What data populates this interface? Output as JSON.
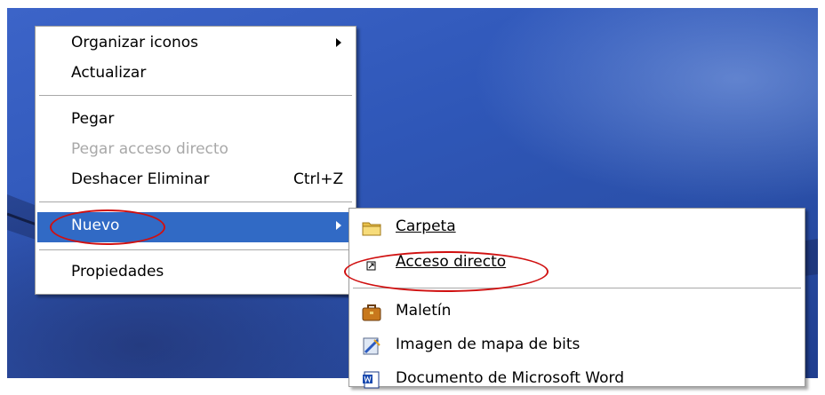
{
  "context_menu": {
    "items": [
      {
        "label": "Organizar iconos",
        "has_submenu": true
      },
      {
        "label": "Actualizar"
      },
      {
        "label": "Pegar"
      },
      {
        "label": "Pegar acceso directo",
        "disabled": true
      },
      {
        "label": "Deshacer Eliminar",
        "shortcut": "Ctrl+Z"
      },
      {
        "label": "Nuevo",
        "has_submenu": true,
        "selected": true
      },
      {
        "label": "Propiedades"
      }
    ]
  },
  "submenu_nuevo": {
    "items": [
      {
        "label": "Carpeta",
        "icon": "folder-icon",
        "mnemonic": "C"
      },
      {
        "label": "Acceso directo",
        "icon": "shortcut-icon",
        "mnemonic": "A"
      },
      {
        "label": "Maletín",
        "icon": "briefcase-icon"
      },
      {
        "label": "Imagen de mapa de bits",
        "icon": "bitmap-icon"
      },
      {
        "label": "Documento de Microsoft Word",
        "icon": "word-doc-icon"
      }
    ]
  },
  "colors": {
    "selection": "#316ac5",
    "highlight_ellipse": "#d01010",
    "desktop": "#2f57b8"
  }
}
